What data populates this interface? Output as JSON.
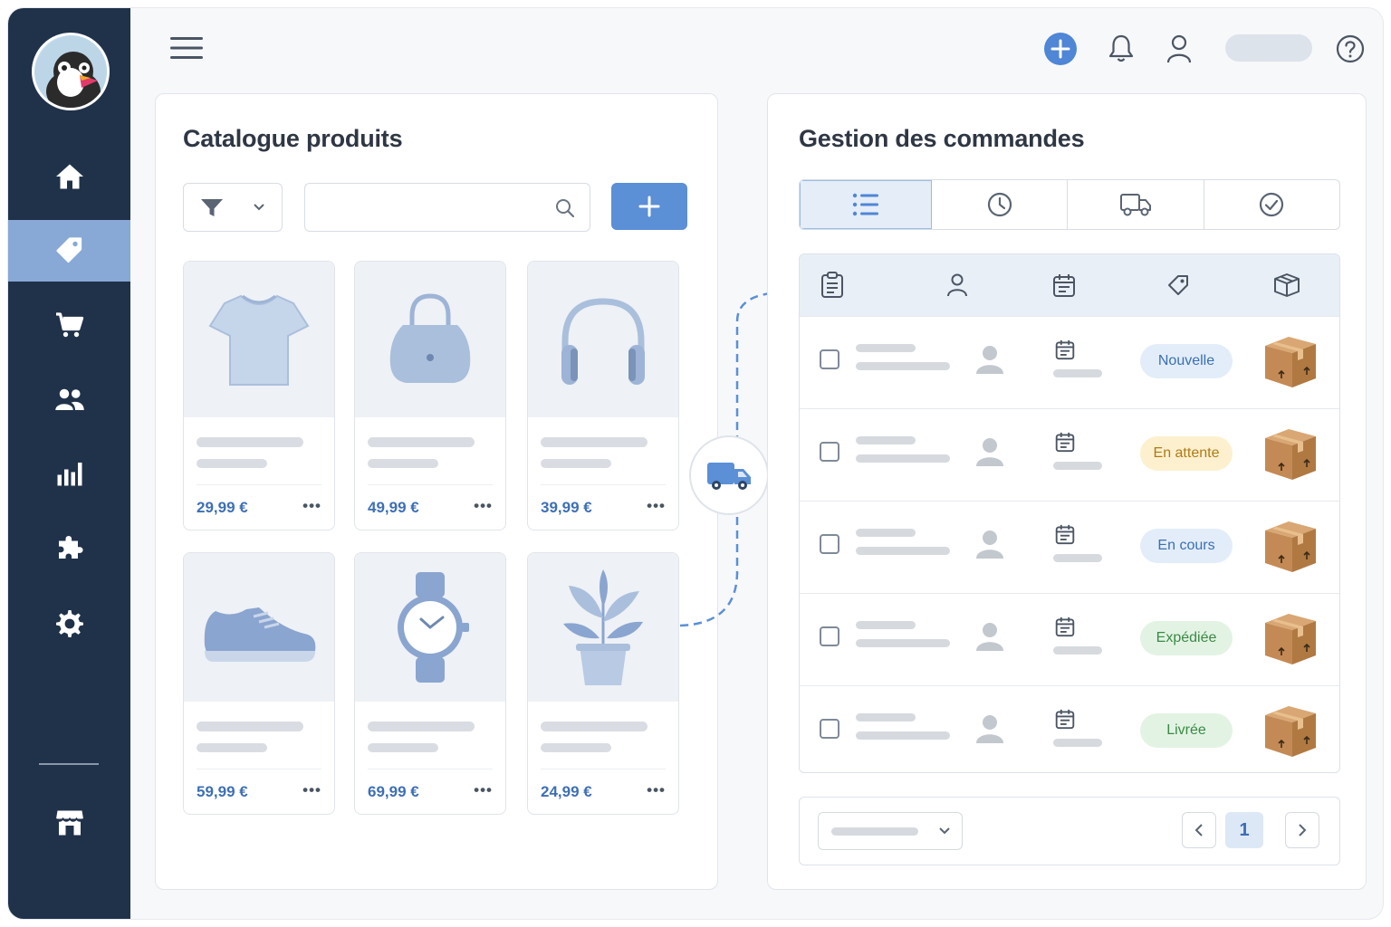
{
  "catalog": {
    "title": "Catalogue produits",
    "search_placeholder": "",
    "products": [
      {
        "icon": "tshirt-icon",
        "price": "29,99 €"
      },
      {
        "icon": "handbag-icon",
        "price": "49,99 €"
      },
      {
        "icon": "headphones-icon",
        "price": "39,99 €"
      },
      {
        "icon": "sneaker-icon",
        "price": "59,99 €"
      },
      {
        "icon": "watch-icon",
        "price": "69,99 €"
      },
      {
        "icon": "plant-icon",
        "price": "24,99 €"
      }
    ]
  },
  "orders": {
    "title": "Gestion des commandes",
    "tabs": [
      "list-icon",
      "clock-icon",
      "truck-icon",
      "check-circle-icon"
    ],
    "columns": [
      "clipboard-icon",
      "user-icon",
      "calendar-icon",
      "tag-icon",
      "box-icon"
    ],
    "rows": [
      {
        "status": "Nouvelle",
        "status_color": "#3b6fb3",
        "status_bg": "#e3edf9"
      },
      {
        "status": "En attente",
        "status_color": "#b07a14",
        "status_bg": "#fdf0cf"
      },
      {
        "status": "En cours",
        "status_color": "#3b6fb3",
        "status_bg": "#e3edf9"
      },
      {
        "status": "Expédiée",
        "status_color": "#3a8a45",
        "status_bg": "#e2f3e3"
      },
      {
        "status": "Livrée",
        "status_color": "#3a8a45",
        "status_bg": "#e2f3e3"
      }
    ],
    "pagination": {
      "current_page": "1"
    }
  },
  "colors": {
    "sidebar": "#20324a",
    "accent": "#5b8fd6",
    "active_nav": "#88a9d6"
  }
}
